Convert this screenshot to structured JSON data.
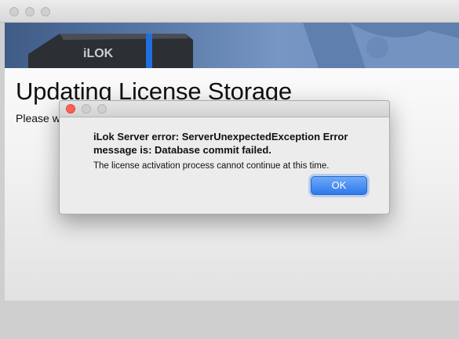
{
  "main_window": {
    "title": "Updating License Storage",
    "subtitle": "Please wa",
    "banner_logo": "iLOK"
  },
  "dialog": {
    "heading": "iLok Server error: ServerUnexpectedException Error message is: Database commit failed.",
    "message": "The license activation process cannot continue at this time.",
    "ok_label": "OK"
  },
  "colors": {
    "close_button": "#fc5f57",
    "ok_button": "#2e79ec",
    "banner": "#5a7aa8"
  }
}
